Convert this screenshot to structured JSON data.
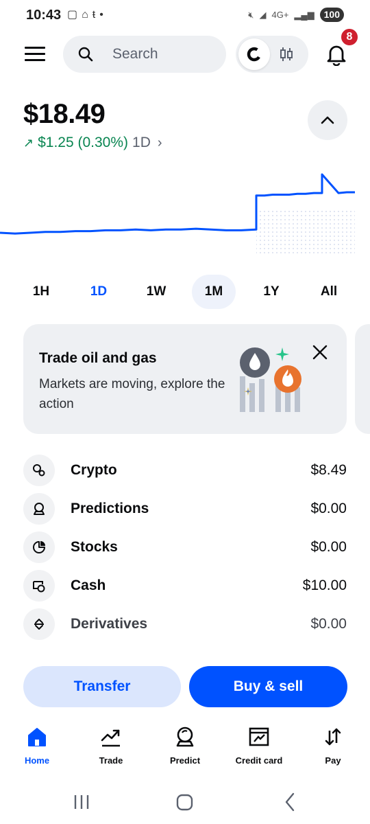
{
  "status_bar": {
    "time": "10:43",
    "battery": "100",
    "network": "4G+"
  },
  "header": {
    "search_placeholder": "Search",
    "notification_count": "8"
  },
  "portfolio": {
    "balance": "$18.49",
    "change": "$1.25 (0.30%)",
    "period": "1D",
    "change_color": "#098551"
  },
  "chart_data": {
    "type": "line",
    "series_color": "#0052ff",
    "range": "1D",
    "y_relative": [
      0.28,
      0.27,
      0.28,
      0.29,
      0.29,
      0.3,
      0.3,
      0.31,
      0.31,
      0.32,
      0.31,
      0.32,
      0.32,
      0.33,
      0.32,
      0.31,
      0.31,
      0.32,
      0.74,
      0.74,
      0.75,
      0.75,
      0.75,
      0.76,
      0.76,
      0.77,
      0.77,
      1.0,
      0.77,
      0.78,
      0.78
    ]
  },
  "ranges": [
    "1H",
    "1D",
    "1W",
    "1M",
    "1Y",
    "All"
  ],
  "active_range": "1D",
  "promo": {
    "title": "Trade oil and gas",
    "body": "Markets are moving, explore the action"
  },
  "assets": [
    {
      "name": "Crypto",
      "value": "$8.49",
      "icon": "crypto-icon"
    },
    {
      "name": "Predictions",
      "value": "$0.00",
      "icon": "predictions-icon"
    },
    {
      "name": "Stocks",
      "value": "$0.00",
      "icon": "stocks-icon"
    },
    {
      "name": "Cash",
      "value": "$10.00",
      "icon": "cash-icon"
    },
    {
      "name": "Derivatives",
      "value": "$0.00",
      "icon": "derivatives-icon"
    }
  ],
  "actions": {
    "transfer": "Transfer",
    "buy_sell": "Buy & sell"
  },
  "bottom_nav": [
    {
      "label": "Home",
      "icon": "home-icon",
      "active": true
    },
    {
      "label": "Trade",
      "icon": "trend-icon",
      "active": false
    },
    {
      "label": "Predict",
      "icon": "predict-icon",
      "active": false
    },
    {
      "label": "Credit card",
      "icon": "credit-card-icon",
      "active": false
    },
    {
      "label": "Pay",
      "icon": "pay-icon",
      "active": false
    }
  ],
  "colors": {
    "accent": "#0052ff",
    "positive": "#098551",
    "badge": "#cf202f"
  }
}
